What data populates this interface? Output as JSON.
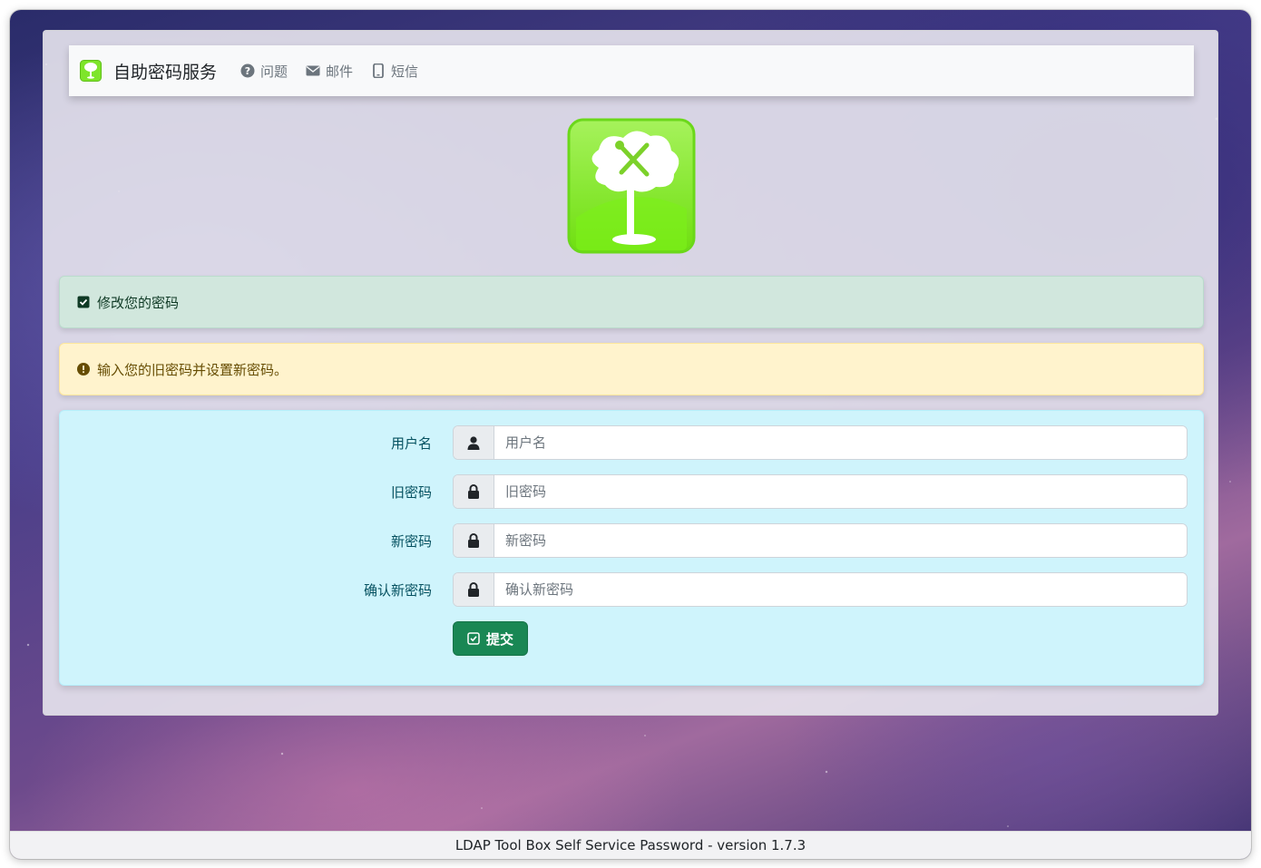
{
  "colors": {
    "success_bg": "#d1e7dd",
    "warning_bg": "#fff3cd",
    "info_bg": "#cff4fc",
    "button_green": "#198754",
    "logo_green": "#7ee52a"
  },
  "navbar": {
    "brand_title": "自助密码服务",
    "brand_icon": "tree-logo-icon",
    "items": [
      {
        "label": "问题",
        "icon": "question-circle-icon"
      },
      {
        "label": "邮件",
        "icon": "envelope-icon"
      },
      {
        "label": "短信",
        "icon": "mobile-phone-icon"
      }
    ]
  },
  "alerts": {
    "success": {
      "text": "修改您的密码",
      "icon": "check-square-icon"
    },
    "warning": {
      "text": "输入您的旧密码并设置新密码。",
      "icon": "exclamation-circle-icon"
    }
  },
  "form": {
    "fields": [
      {
        "label": "用户名",
        "placeholder": "用户名",
        "value": "",
        "icon": "user-icon"
      },
      {
        "label": "旧密码",
        "placeholder": "旧密码",
        "value": "",
        "icon": "lock-icon"
      },
      {
        "label": "新密码",
        "placeholder": "新密码",
        "value": "",
        "icon": "lock-icon"
      },
      {
        "label": "确认新密码",
        "placeholder": "确认新密码",
        "value": "",
        "icon": "lock-icon"
      }
    ],
    "submit_label": "提交",
    "submit_icon": "check-square-icon"
  },
  "footer": {
    "text": "LDAP Tool Box Self Service Password - version 1.7.3"
  }
}
